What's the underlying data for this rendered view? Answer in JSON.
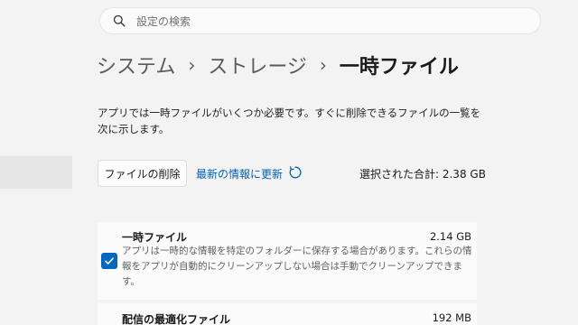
{
  "search": {
    "placeholder": "設定の検索",
    "icon": "search-icon"
  },
  "breadcrumb": {
    "items": [
      "システム",
      "ストレージ",
      "一時ファイル"
    ],
    "separator": "›"
  },
  "description": "アプリでは一時ファイルがいくつか必要です。すぐに削除できるファイルの一覧を次に示します。",
  "toolbar": {
    "delete_label": "ファイルの削除",
    "refresh_label": "最新の情報に更新",
    "total_text": "選択された合計: 2.38 GB"
  },
  "items": [
    {
      "title": "一時ファイル",
      "size": "2.14 GB",
      "checked": true,
      "description": "アプリは一時的な情報を特定のフォルダーに保存する場合があります。これらの情報をアプリが自動的にクリーンアップしない場合は手動でクリーンアップできます。"
    },
    {
      "title": "配信の最適化ファイル",
      "size": "192 MB"
    }
  ],
  "colors": {
    "accent": "#0067c0",
    "link": "#0060b8",
    "background": "#f3f3f3"
  }
}
